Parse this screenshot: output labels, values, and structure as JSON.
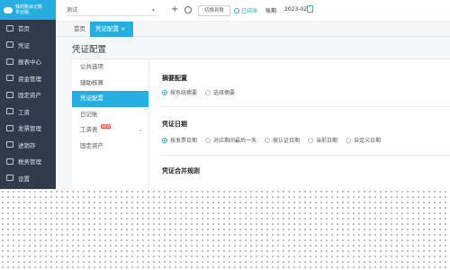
{
  "sidebar": {
    "brand_line1": "我的账目记账",
    "brand_line2": "专业版",
    "items": [
      {
        "label": "首页",
        "icon": "home-icon"
      },
      {
        "label": "凭证",
        "icon": "voucher-icon"
      },
      {
        "label": "报表中心",
        "icon": "report-icon"
      },
      {
        "label": "资金管理",
        "icon": "wallet-icon"
      },
      {
        "label": "固定资产",
        "icon": "asset-icon"
      },
      {
        "label": "工资",
        "icon": "salary-icon"
      },
      {
        "label": "发票管理",
        "icon": "invoice-icon"
      },
      {
        "label": "进销存",
        "icon": "inventory-icon"
      },
      {
        "label": "税务管理",
        "icon": "tax-icon"
      },
      {
        "label": "设置",
        "icon": "settings-icon"
      }
    ]
  },
  "topbar": {
    "company": "测试",
    "switch_label": "切换到账",
    "done_label": "已结账",
    "period_label": "账期",
    "period_value": "2023-02"
  },
  "tabs": {
    "home": "首页",
    "active": "凭证配置 ×"
  },
  "page": {
    "title": "凭证配置"
  },
  "subnav": [
    {
      "label": "公共选项",
      "active": false
    },
    {
      "label": "辅助核算",
      "active": false
    },
    {
      "label": "凭证配置",
      "active": true
    },
    {
      "label": "日记账",
      "active": false
    },
    {
      "label": "工资表",
      "active": false,
      "badge": "NEW"
    },
    {
      "label": "固定资产",
      "active": false
    }
  ],
  "sections": {
    "summary": {
      "title": "摘要配置",
      "options": [
        "按系统摘要",
        "选择摘要"
      ]
    },
    "date": {
      "title": "凭证日期",
      "options": [
        "按发票日期",
        "对应期间最后一天",
        "按认证日期",
        "当前日期",
        "自定义日期"
      ]
    },
    "merge": {
      "title": "凭证合并规则"
    }
  },
  "colors": {
    "accent": "#27aee0",
    "sidebar_bg": "#2f3a4a"
  }
}
